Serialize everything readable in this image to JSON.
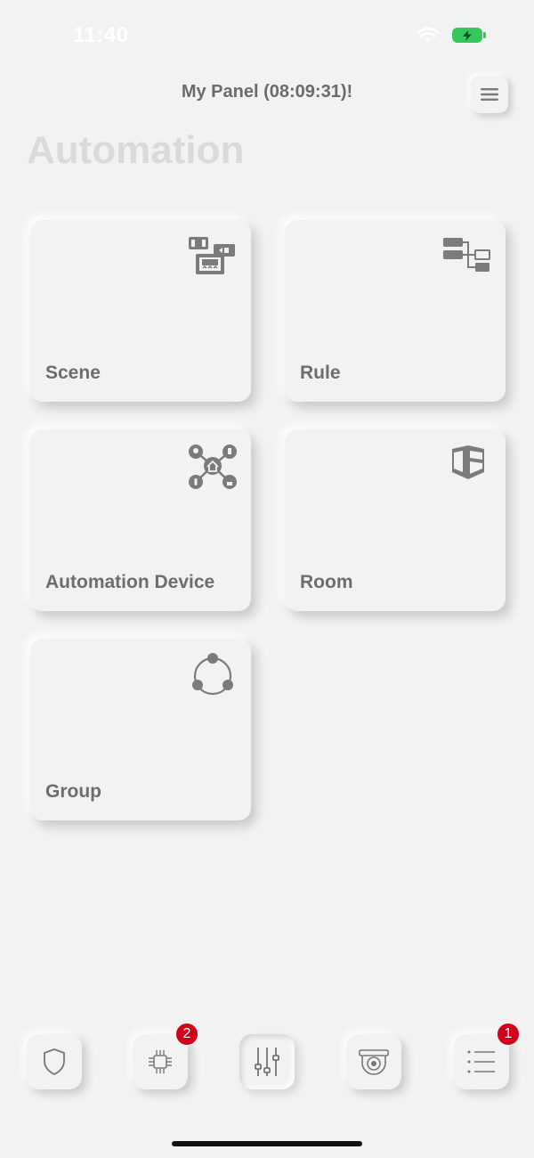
{
  "status_bar": {
    "time": "11:40"
  },
  "header": {
    "title": "My Panel (08:09:31)!"
  },
  "page": {
    "title": "Automation"
  },
  "cards": [
    {
      "label": "Scene",
      "icon": "scene-icon"
    },
    {
      "label": "Rule",
      "icon": "rule-icon"
    },
    {
      "label": "Automation Device",
      "icon": "automation-device-icon"
    },
    {
      "label": "Room",
      "icon": "room-cube-icon"
    },
    {
      "label": "Group",
      "icon": "group-icon"
    }
  ],
  "bottom_nav": [
    {
      "name": "security",
      "icon": "shield-icon",
      "badge": ""
    },
    {
      "name": "devices",
      "icon": "chip-icon",
      "badge": "2"
    },
    {
      "name": "automation",
      "icon": "sliders-icon",
      "badge": "",
      "active": true
    },
    {
      "name": "camera",
      "icon": "camera-icon",
      "badge": ""
    },
    {
      "name": "list",
      "icon": "list-icon",
      "badge": "1"
    }
  ],
  "colors": {
    "background": "#f2f2f2",
    "text": "#6d6d6d",
    "title_faded": "#dadada",
    "badge": "#d0021b",
    "battery": "#34c759"
  }
}
